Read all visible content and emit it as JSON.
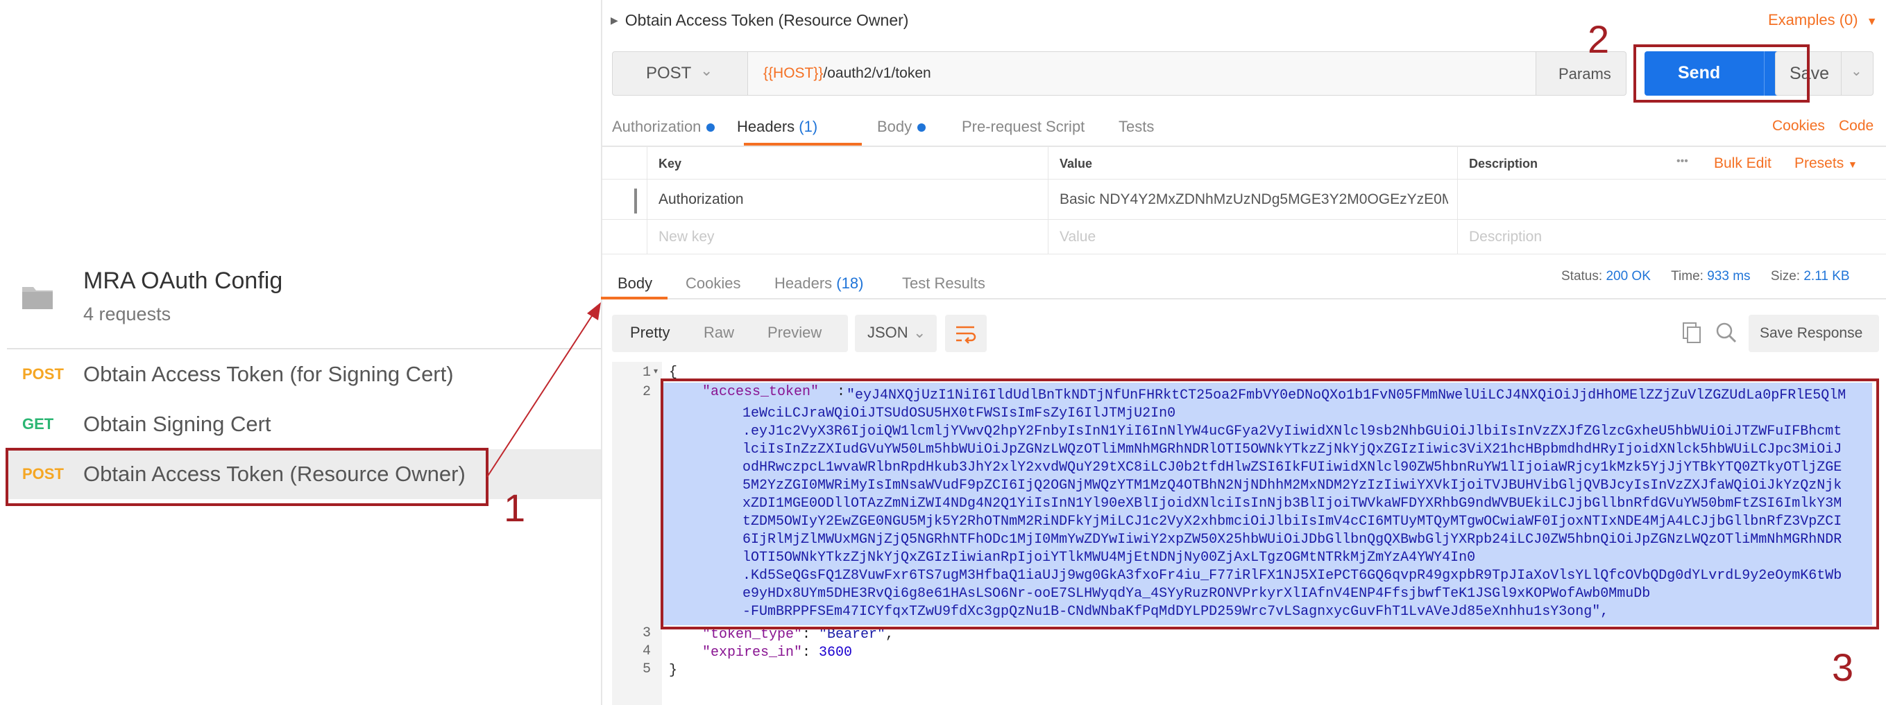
{
  "sidebar": {
    "collection_name": "MRA OAuth Config",
    "collection_count": "4 requests",
    "requests": [
      {
        "method": "POST",
        "name": "Obtain Access Token (for Signing Cert)"
      },
      {
        "method": "GET",
        "name": "Obtain Signing Cert"
      },
      {
        "method": "POST",
        "name": "Obtain Access Token (Resource Owner)"
      }
    ]
  },
  "request": {
    "title": "Obtain Access Token (Resource Owner)",
    "examples": "Examples (0)",
    "method": "POST",
    "url_var": "{{HOST}}",
    "url_path": "/oauth2/v1/token",
    "params_label": "Params",
    "send_label": "Send",
    "save_label": "Save",
    "tabs": {
      "authorization": "Authorization",
      "headers": "Headers",
      "headers_count": "(1)",
      "body": "Body",
      "prerequest": "Pre-request Script",
      "tests": "Tests"
    },
    "cookies_link": "Cookies",
    "code_link": "Code"
  },
  "headers_table": {
    "columns": {
      "key": "Key",
      "value": "Value",
      "description": "Description"
    },
    "more": "•••",
    "bulk_edit": "Bulk Edit",
    "presets": "Presets",
    "row": {
      "key": "Authorization",
      "value": "Basic NDY4Y2MxZDNhMzUzNDg5MGE3Y2M0OGEzYzE0M..."
    },
    "placeholder": {
      "key": "New key",
      "value": "Value",
      "description": "Description"
    }
  },
  "response": {
    "tabs": {
      "body": "Body",
      "cookies": "Cookies",
      "headers": "Headers",
      "headers_count": "(18)",
      "test_results": "Test Results"
    },
    "status_label": "Status:",
    "status_value": "200 OK",
    "time_label": "Time:",
    "time_value": "933 ms",
    "size_label": "Size:",
    "size_value": "2.11 KB",
    "views": [
      "Pretty",
      "Raw",
      "Preview"
    ],
    "format": "JSON",
    "save_response": "Save Response",
    "code": {
      "line_numbers": [
        "1",
        "2",
        "3",
        "4",
        "5"
      ],
      "open_brace": "{",
      "close_brace": "}",
      "access_token_key": "\"access_token\"",
      "token_lines": [
        "\"eyJ4NXQjUzI1NiI6IldUdlBnTkNDTjNfUnFHRktCT25oa2FmbVY0eDNoQXo1b1FvN05FMmNwelUiLCJ4NXQiOiJjdHhOMElZZjZuVlZGZUdLa0pFRlE5QlM",
        "1eWciLCJraWQiOiJTSUdOSU5HX0tFWSIsImFsZyI6IlJTMjU2In0",
        ".eyJ1c2VyX3R6IjoiQW1lcmljYVwvQ2hpY2FnbyIsInN1YiI6InNlYW4ucGFya2VyIiwidXNlcl9sb2NhbGUiOiJlbiIsInVzZXJfZGlzcGxheU5hbWUiOiJTZWFuIFBhcmt",
        "lciIsInZzZXIudGVuYW50Lm5hbWUiOiJpZGNzLWQzOTliMmNhMGRhNDRlOTI5OWNkYTkzZjNkYjQxZGIzIiwic3ViX21hcHBpbmdhdHRyIjoidXNlck5hbWUiLCJpc3MiOiJ",
        "odHRwczpcL1wvaWRlbnRpdHkub3JhY2xlY2xvdWQuY29tXC8iLCJ0b2tfdHlwZSI6IkFUIiwidXNlcl90ZW5hbnRuYW1lIjoiaWRjcy1kMzk5YjJjYTBkYTQ0ZTkyOTljZGE",
        "5M2YzZGI0MWRiMyIsImNsaWVudF9pZCI6IjQ2OGNjMWQzYTM1MzQ4OTBhN2NjNDhhM2MxNDM2YzIzIiwiYXVkIjoiTVJBUHVibGljQVBJcyIsInVzZXJfaWQiOiJkYzQzNjk",
        "xZDI1MGE0ODllOTAzZmNiZWI4NDg4N2Q1YiIsInN1Yl90eXBlIjoidXNlciIsInNjb3BlIjoiTWVkaWFDYXRhbG9ndWVBUEkiLCJjbGllbnRfdGVuYW50bmFtZSI6ImlkY3M",
        "tZDM5OWIyY2EwZGE0NGU5Mjk5Y2RhOTNmM2RiNDFkYjMiLCJ1c2VyX2xhbmciOiJlbiIsImV4cCI6MTUyMTQyMTgwOCwiaWF0IjoxNTIxNDE4MjA4LCJjbGllbnRfZ3VpZCI",
        "6IjRlMjZlMWUxMGNjZjQ5NGRhNTFhODc1MjI0MmYwZDYwIiwiY2xpZW50X25hbWUiOiJDbGllbnQgQXBwbGljYXRpb24iLCJ0ZW5hbnQiOiJpZGNzLWQzOTliMmNhMGRhNDR",
        "lOTI5OWNkYTkzZjNkYjQxZGIzIiwianRpIjoiYTlkMWU4MjEtNDNjNy00ZjAxLTgzOGMtNTRkMjZmYzA4YWY4In0",
        ".Kd5SeQGsFQ1Z8VuwFxr6TS7ugM3HfbaQ1iaUJj9wg0GkA3fxoFr4iu_F77iRlFX1NJ5XIePCT6GQ6qvpR49gxpbR9TpJIaXoVlsYLlQfcOVbQDg0dYLvrdL9y2eOymK6tWb",
        "e9yHDx8UYm5DHE3RvQi6g8e61HAsLSO6Nr-ooE7SLHWyqdYa_4SYyRuzRONVPrkyrXlIAfnV4ENP4FfsjbwfTeK1JSGl9xKOPWofAwb0MmuDb",
        "-FUmBRPPFSEm47ICYfqxTZwU9fdXc3gpQzNu1B-CNdWNbaKfPqMdDYLPD259Wrc7vLSagnxycGuvFhT1LvAVeJd85eXnhhu1sY3ong\","
      ],
      "token_type_line": "\"token_type\": \"Bearer\",",
      "token_type_key": "\"token_type\"",
      "token_type_value": "\"Bearer\"",
      "expires_key": "\"expires_in\"",
      "expires_value": "3600"
    }
  },
  "annotations": [
    "1",
    "2",
    "3"
  ],
  "colors": {
    "accent_orange": "#f47023",
    "send_blue": "#1a73e8",
    "annotation_red": "#a31f24",
    "selection": "#c6d7fb"
  },
  "icons": [
    "folder-icon",
    "chevron-down-icon",
    "wrap-icon",
    "copy-icon",
    "search-icon",
    "collapse-triangle-icon"
  ]
}
